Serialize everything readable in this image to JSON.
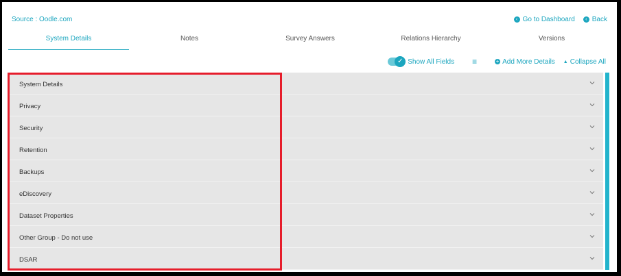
{
  "header": {
    "source": "Source : Oodle.com",
    "go_to_dashboard": "Go to Dashboard",
    "back": "Back"
  },
  "tabs": [
    {
      "label": "System Details",
      "active": true
    },
    {
      "label": "Notes"
    },
    {
      "label": "Survey Answers"
    },
    {
      "label": "Relations Hierarchy"
    },
    {
      "label": "Versions"
    }
  ],
  "toolbar": {
    "show_all_fields": "Show All Fields",
    "add_more_details": "Add More Details",
    "collapse_all": "Collapse All"
  },
  "sections": [
    "System Details",
    "Privacy",
    "Security",
    "Retention",
    "Backups",
    "eDiscovery",
    "Dataset Properties",
    "Other Group - Do not use",
    "DSAR"
  ],
  "colors": {
    "accent": "#1ca6bf",
    "highlight": "#e61d2b",
    "panel": "#e6e6e6"
  }
}
